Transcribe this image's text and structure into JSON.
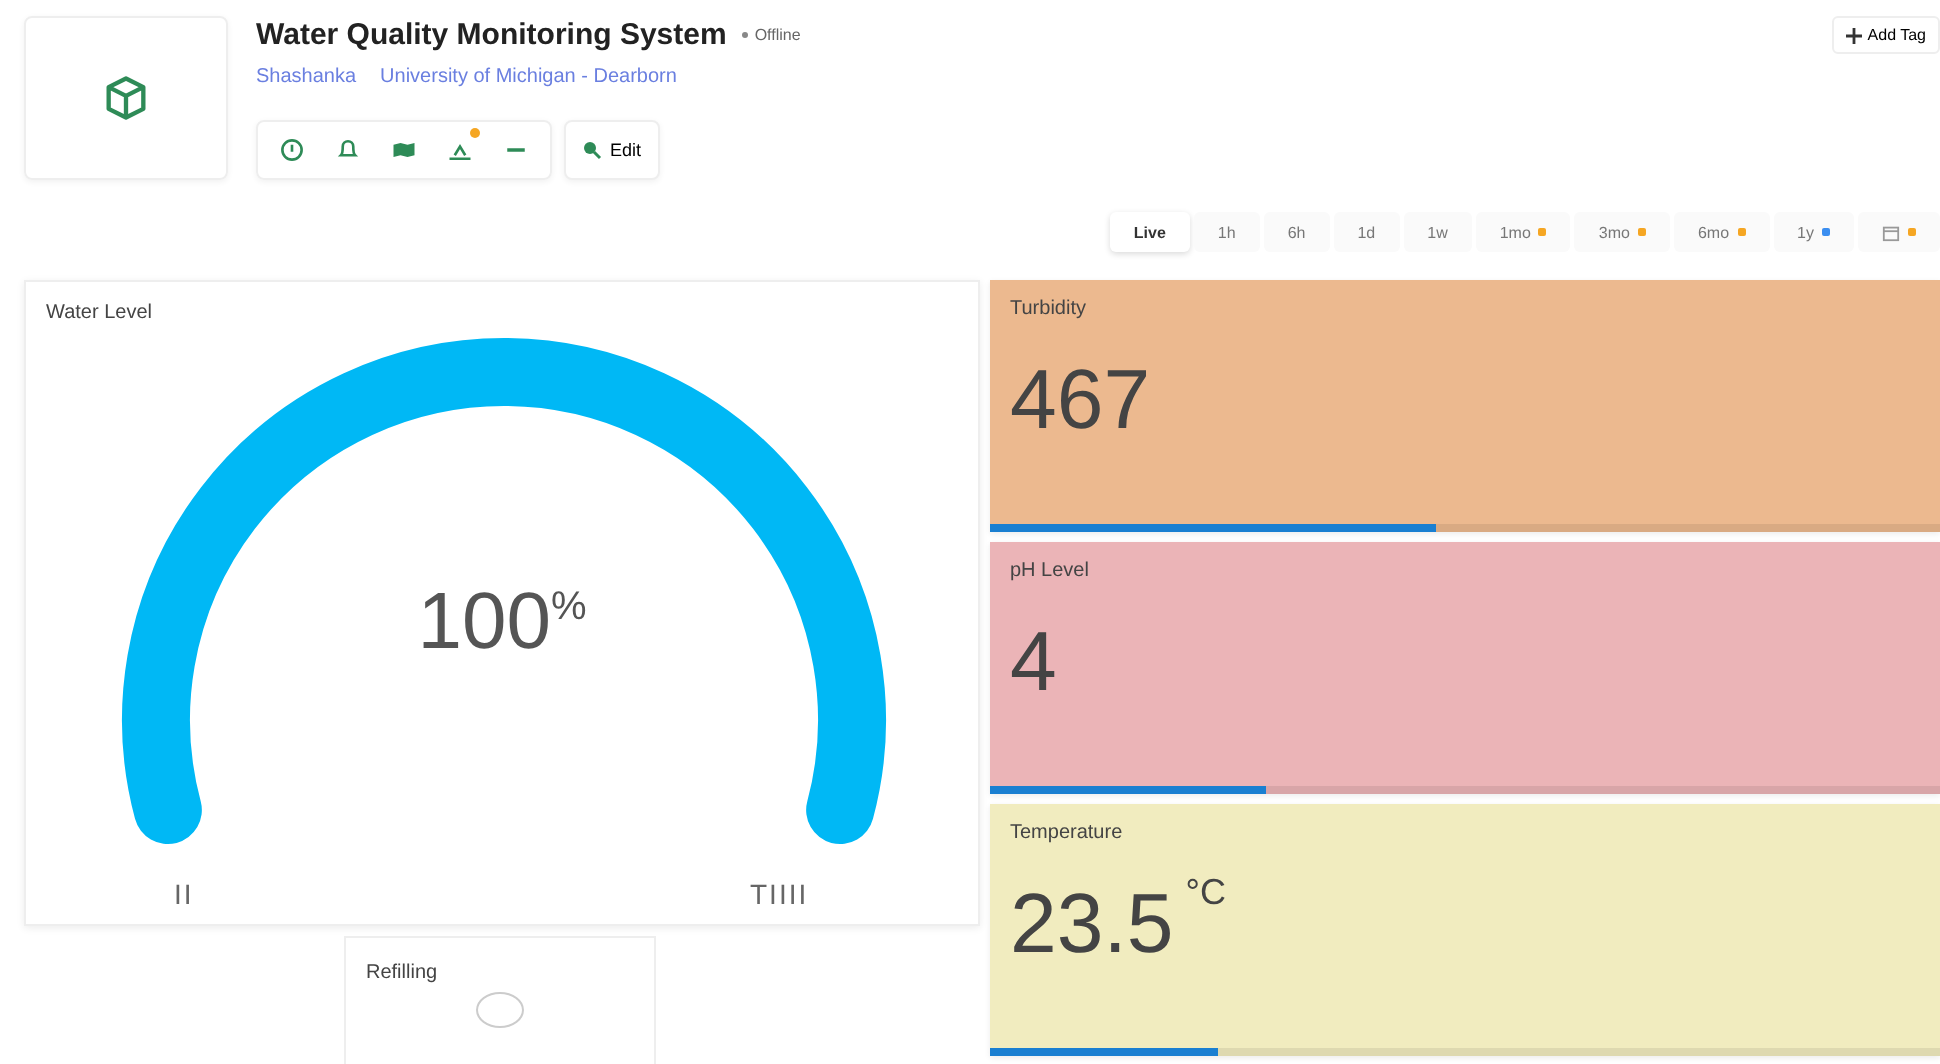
{
  "header": {
    "title": "Water Quality Monitoring System",
    "status": "Offline",
    "owner": "Shashanka",
    "organization": "University of Michigan - Dearborn",
    "add_tag": "Add Tag",
    "edit": "Edit"
  },
  "toolbar": [
    {
      "kind": "info",
      "badge": false
    },
    {
      "kind": "bell",
      "badge": false
    },
    {
      "kind": "map",
      "badge": false
    },
    {
      "kind": "chart",
      "badge": true
    },
    {
      "kind": "dash",
      "badge": false
    }
  ],
  "time_ranges": [
    {
      "kind": "text",
      "label": "Live",
      "selected": true
    },
    {
      "kind": "text",
      "label": "1h",
      "selected": false
    },
    {
      "kind": "text",
      "label": "6h",
      "selected": false
    },
    {
      "kind": "text",
      "label": "1d",
      "selected": false
    },
    {
      "kind": "text",
      "label": "1w",
      "selected": false
    },
    {
      "kind": "text",
      "label": "1mo",
      "selected": false,
      "color": "#f5a623"
    },
    {
      "kind": "text",
      "label": "3mo",
      "selected": false,
      "color": "#f5a623"
    },
    {
      "kind": "text",
      "label": "6mo",
      "selected": false,
      "color": "#f5a623"
    },
    {
      "kind": "text",
      "label": "1y",
      "selected": false,
      "color": "#3b8ef0"
    },
    {
      "kind": "calendar",
      "selected": false,
      "color": "#f5a623"
    }
  ],
  "water_level": {
    "title": "Water Level",
    "value": "100",
    "unit": "%",
    "min_label": "II",
    "max_label": "TIIII"
  },
  "refilling": {
    "title": "Refilling",
    "on": false
  },
  "metrics": [
    {
      "title": "Turbidity",
      "value": "467",
      "color": "#ecb98f",
      "level": 0.47
    },
    {
      "title": "pH Level",
      "value": "4",
      "color": "#ebb4b7",
      "level": 0.29
    },
    {
      "title": "Temperature",
      "value": "23.5",
      "unit": "°C",
      "color": "#f1ecbf",
      "level": 0.24
    }
  ]
}
